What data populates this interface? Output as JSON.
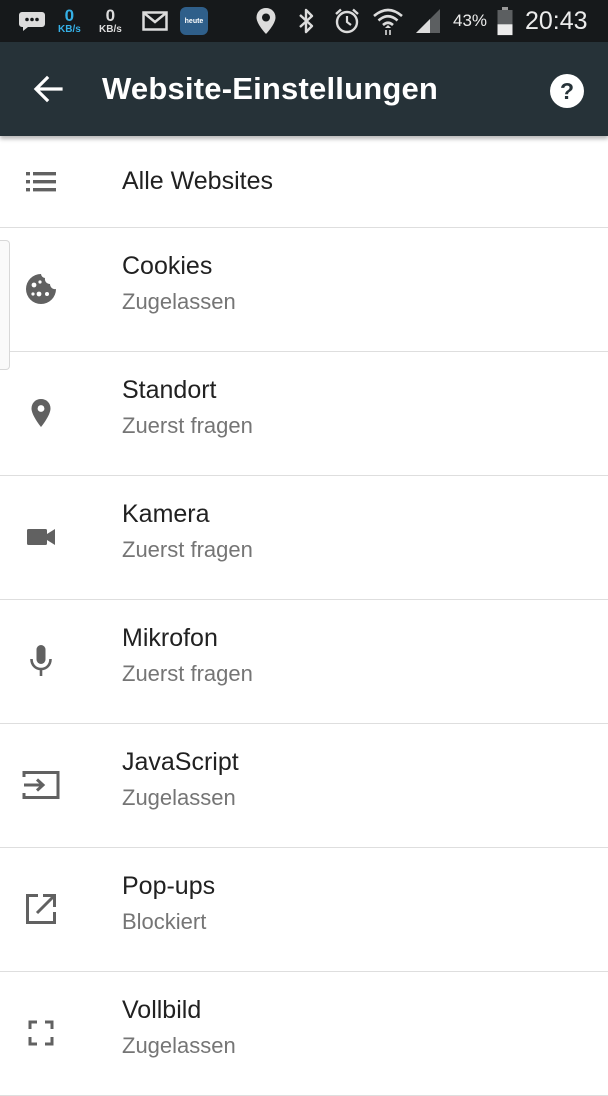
{
  "status_bar": {
    "rx_value": "0",
    "rx_unit": "KB/s",
    "tx_value": "0",
    "tx_unit": "KB/s",
    "notif_app_label": "heute",
    "battery_percent": "43%",
    "battery_level": 0.43,
    "time": "20:43",
    "icons": [
      "messages-icon",
      "gmail-icon",
      "heute-app-icon",
      "location-icon",
      "bluetooth-icon",
      "alarm-icon",
      "wifi-icon",
      "signal-icon",
      "battery-icon"
    ]
  },
  "app_bar": {
    "title": "Website-Einstellungen",
    "back_icon": "arrow-back-icon",
    "help_icon": "help-circle-icon",
    "background": "#263238"
  },
  "settings": {
    "all_sites": {
      "label": "Alle Websites",
      "icon": "list-icon"
    },
    "items": [
      {
        "label": "Cookies",
        "value": "Zugelassen",
        "icon": "cookie-icon"
      },
      {
        "label": "Standort",
        "value": "Zuerst fragen",
        "icon": "location-pin-icon"
      },
      {
        "label": "Kamera",
        "value": "Zuerst fragen",
        "icon": "videocam-icon"
      },
      {
        "label": "Mikrofon",
        "value": "Zuerst fragen",
        "icon": "mic-icon"
      },
      {
        "label": "JavaScript",
        "value": "Zugelassen",
        "icon": "input-arrow-icon"
      },
      {
        "label": "Pop-ups",
        "value": "Blockiert",
        "icon": "open-in-new-icon"
      },
      {
        "label": "Vollbild",
        "value": "Zugelassen",
        "icon": "fullscreen-icon"
      }
    ]
  }
}
